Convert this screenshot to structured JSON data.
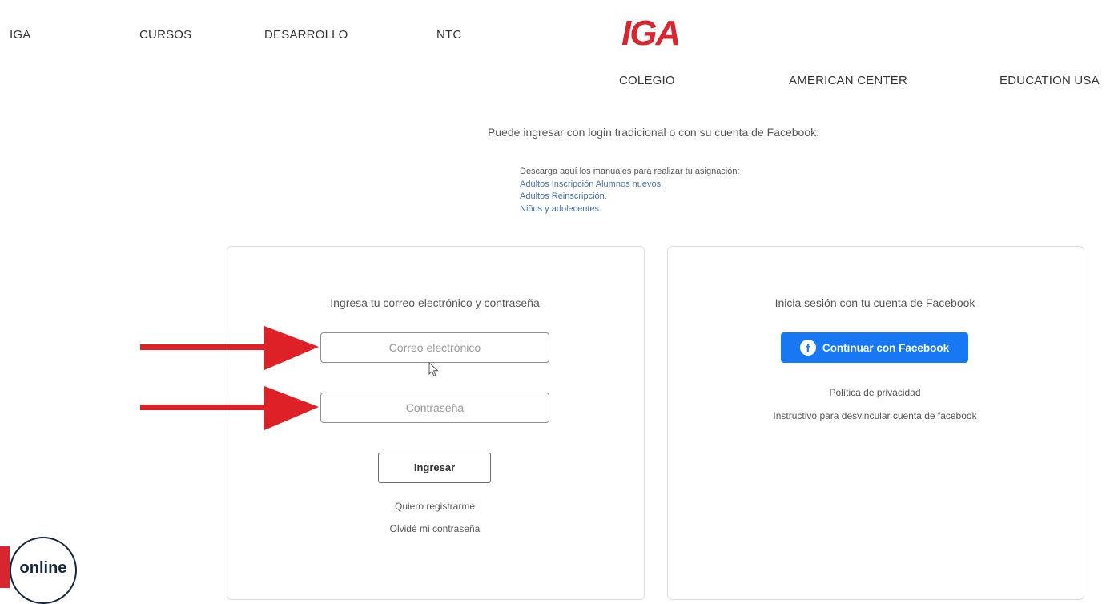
{
  "nav": {
    "top_items": [
      "IGA",
      "CURSOS",
      "DESARROLLO",
      "NTC"
    ],
    "logo": "IGA",
    "second_items": [
      "COLEGIO",
      "AMERICAN CENTER",
      "EDUCATION USA"
    ]
  },
  "intro_text": "Puede ingresar con login tradicional o con su cuenta de Facebook.",
  "manuals": {
    "label": "Descarga aquí los manuales para realizar tu asignación:",
    "links": [
      "Adultos Inscripción Alumnos nuevos.",
      "Adultos Reinscripción.",
      "Niños y adolecentes."
    ]
  },
  "login_card": {
    "title": "Ingresa tu correo electrónico y contraseña",
    "email_placeholder": "Correo electrónico",
    "password_placeholder": "Contraseña",
    "submit_label": "Ingresar",
    "register_link": "Quiero registrarme",
    "forgot_link": "Olvidé mi contraseña"
  },
  "facebook_card": {
    "title": "Inicia sesión con tu cuenta de Facebook",
    "button_label": "Continuar con Facebook",
    "privacy_link": "Política de privacidad",
    "unlink_link": "Instructivo para desvincular cuenta de facebook"
  },
  "badge": {
    "text": "online"
  },
  "colors": {
    "brand_red": "#d7262f",
    "facebook_blue": "#1877f2",
    "arrow_red": "#dd2127"
  },
  "icons": [
    "facebook-icon",
    "mouse-cursor-icon",
    "arrow-right-icon"
  ]
}
